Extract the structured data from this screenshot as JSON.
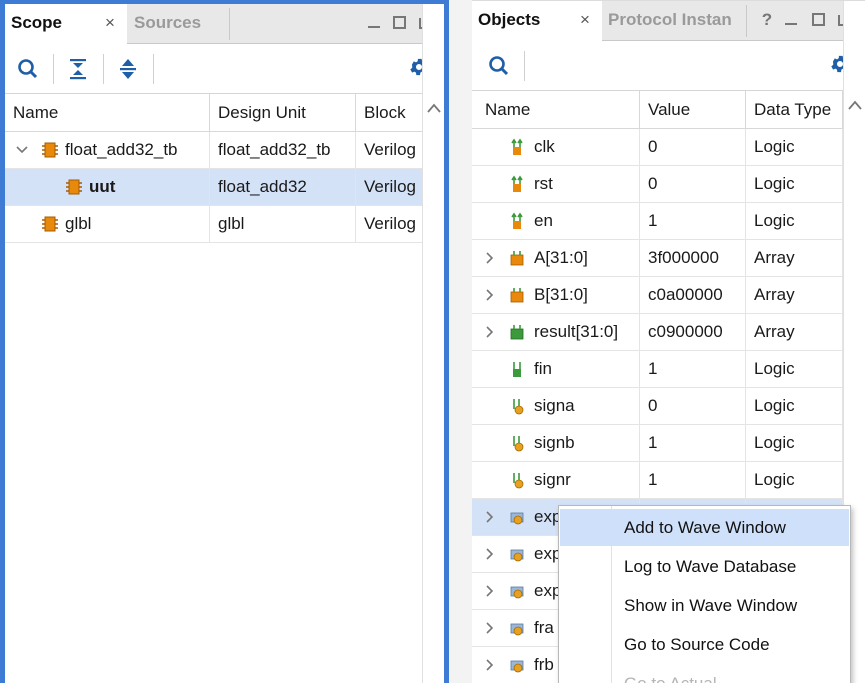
{
  "scope_panel": {
    "tabs": [
      {
        "label": "Scope",
        "close": "×"
      },
      {
        "label": "Sources"
      }
    ],
    "window_controls": [
      "minimize",
      "maximize",
      "float"
    ],
    "toolbar": [
      "search-icon",
      "collapse-all-icon",
      "expand-all-icon",
      "gear-icon"
    ],
    "columns": [
      "Name",
      "Design Unit",
      "Block"
    ],
    "rows": [
      {
        "name": "float_add32_tb",
        "design_unit": "float_add32_tb",
        "block": "Verilog",
        "expanded": true,
        "level": 0,
        "selected": false
      },
      {
        "name": "uut",
        "design_unit": "float_add32",
        "block": "Verilog",
        "level": 1,
        "selected": true
      },
      {
        "name": "glbl",
        "design_unit": "glbl",
        "block": "Verilog",
        "level": 0,
        "selected": false
      }
    ]
  },
  "objects_panel": {
    "tabs": [
      {
        "label": "Objects",
        "close": "×"
      },
      {
        "label": "Protocol Instan"
      }
    ],
    "help": "?",
    "window_controls": [
      "minimize",
      "maximize",
      "float"
    ],
    "toolbar": [
      "search-icon",
      "gear-icon"
    ],
    "columns": [
      "Name",
      "Value",
      "Data Type"
    ],
    "rows": [
      {
        "name": "clk",
        "value": "0",
        "type": "Logic",
        "icon": "input-signal-icon",
        "expandable": false
      },
      {
        "name": "rst",
        "value": "0",
        "type": "Logic",
        "icon": "input-signal-icon",
        "expandable": false
      },
      {
        "name": "en",
        "value": "1",
        "type": "Logic",
        "icon": "input-signal-icon",
        "expandable": false
      },
      {
        "name": "A[31:0]",
        "value": "3f000000",
        "type": "Array",
        "icon": "input-bus-icon",
        "expandable": true
      },
      {
        "name": "B[31:0]",
        "value": "c0a00000",
        "type": "Array",
        "icon": "input-bus-icon",
        "expandable": true
      },
      {
        "name": "result[31:0]",
        "value": "c0900000",
        "type": "Array",
        "icon": "output-bus-icon",
        "expandable": true
      },
      {
        "name": "fin",
        "value": "1",
        "type": "Logic",
        "icon": "output-signal-icon",
        "expandable": false
      },
      {
        "name": "signa",
        "value": "0",
        "type": "Logic",
        "icon": "internal-signal-icon",
        "expandable": false
      },
      {
        "name": "signb",
        "value": "1",
        "type": "Logic",
        "icon": "internal-signal-icon",
        "expandable": false
      },
      {
        "name": "signr",
        "value": "1",
        "type": "Logic",
        "icon": "internal-signal-icon",
        "expandable": false
      },
      {
        "name": "exp",
        "value": "",
        "type": "",
        "icon": "internal-bus-icon",
        "expandable": true,
        "selected": true
      },
      {
        "name": "exp",
        "value": "",
        "type": "",
        "icon": "internal-bus-icon",
        "expandable": true
      },
      {
        "name": "exp",
        "value": "",
        "type": "",
        "icon": "internal-bus-icon",
        "expandable": true
      },
      {
        "name": "fra",
        "value": "",
        "type": "",
        "icon": "internal-bus-icon",
        "expandable": true
      },
      {
        "name": "frb",
        "value": "",
        "type": "",
        "icon": "internal-bus-icon",
        "expandable": true
      }
    ]
  },
  "context_menu": {
    "items": [
      {
        "label": "Add to Wave Window",
        "state": "hover"
      },
      {
        "label": "Log to Wave Database",
        "state": "normal"
      },
      {
        "label": "Show in Wave Window",
        "state": "normal"
      },
      {
        "label": "Go to Source Code",
        "state": "normal"
      },
      {
        "label": "Go to Actual",
        "state": "disabled"
      }
    ]
  },
  "colors": {
    "active_panel_border": "#3d7bd4",
    "selection": "#d4e2f8",
    "menu_hover": "#cfe0fa",
    "module_icon": "#e8890c",
    "input_icon": "#e8890c",
    "output_icon": "#3c9a3c"
  }
}
